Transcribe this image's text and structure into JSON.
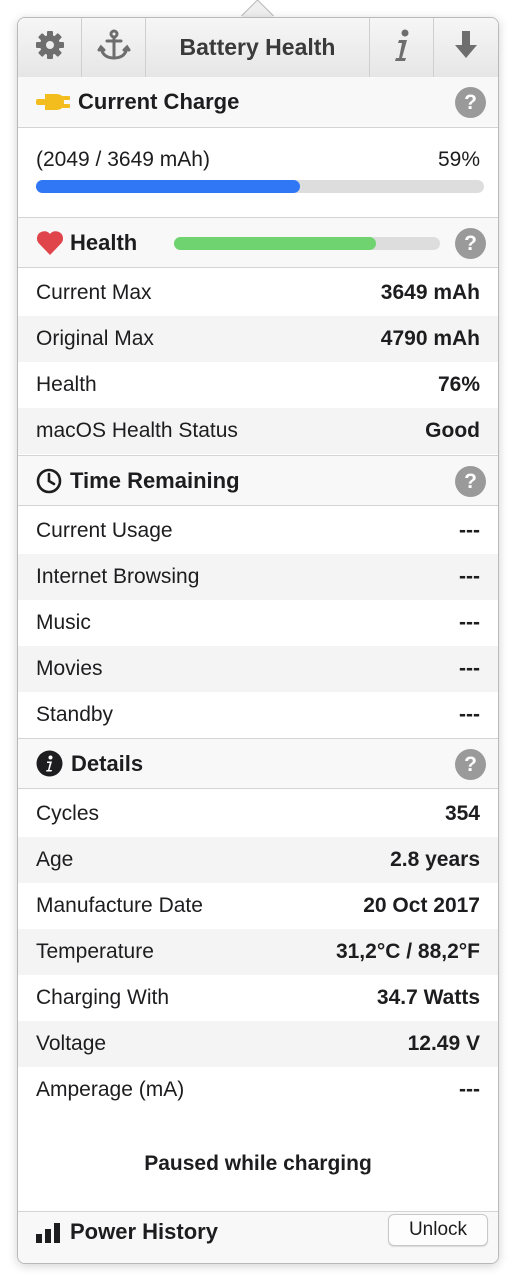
{
  "toolbar": {
    "title": "Battery Health",
    "icons": [
      "gear-icon",
      "anchor-icon",
      "info-icon",
      "download-arrow-icon"
    ]
  },
  "current_charge": {
    "title": "Current Charge",
    "capacity": "(2049 / 3649 mAh)",
    "percent": "59%",
    "fill_fraction": 0.59,
    "bar_color": "#2f77f5",
    "icon": "plug-icon"
  },
  "health": {
    "title": "Health",
    "fill_fraction": 0.76,
    "bar_color": "#6fd46f",
    "icon": "heart-icon",
    "rows": [
      {
        "label": "Current Max",
        "value": "3649 mAh"
      },
      {
        "label": "Original Max",
        "value": "4790 mAh"
      },
      {
        "label": "Health",
        "value": "76%"
      },
      {
        "label": "macOS Health Status",
        "value": "Good"
      }
    ]
  },
  "time_remaining": {
    "title": "Time Remaining",
    "icon": "clock-icon",
    "rows": [
      {
        "label": "Current Usage",
        "value": "---"
      },
      {
        "label": "Internet Browsing",
        "value": "---"
      },
      {
        "label": "Music",
        "value": "---"
      },
      {
        "label": "Movies",
        "value": "---"
      },
      {
        "label": "Standby",
        "value": "---"
      }
    ]
  },
  "details": {
    "title": "Details",
    "icon": "info-circle-icon",
    "rows": [
      {
        "label": "Cycles",
        "value": "354"
      },
      {
        "label": "Age",
        "value": "2.8 years"
      },
      {
        "label": "Manufacture Date",
        "value": "20 Oct 2017"
      },
      {
        "label": "Temperature",
        "value": "31,2°C / 88,2°F"
      },
      {
        "label": "Charging With",
        "value": "34.7 Watts"
      },
      {
        "label": "Voltage",
        "value": "12.49 V"
      },
      {
        "label": "Amperage (mA)",
        "value": "---"
      }
    ]
  },
  "status_message": "Paused while charging",
  "footer": {
    "title": "Power History",
    "icon": "bar-chart-icon",
    "unlock_label": "Unlock"
  },
  "help_label": "?"
}
